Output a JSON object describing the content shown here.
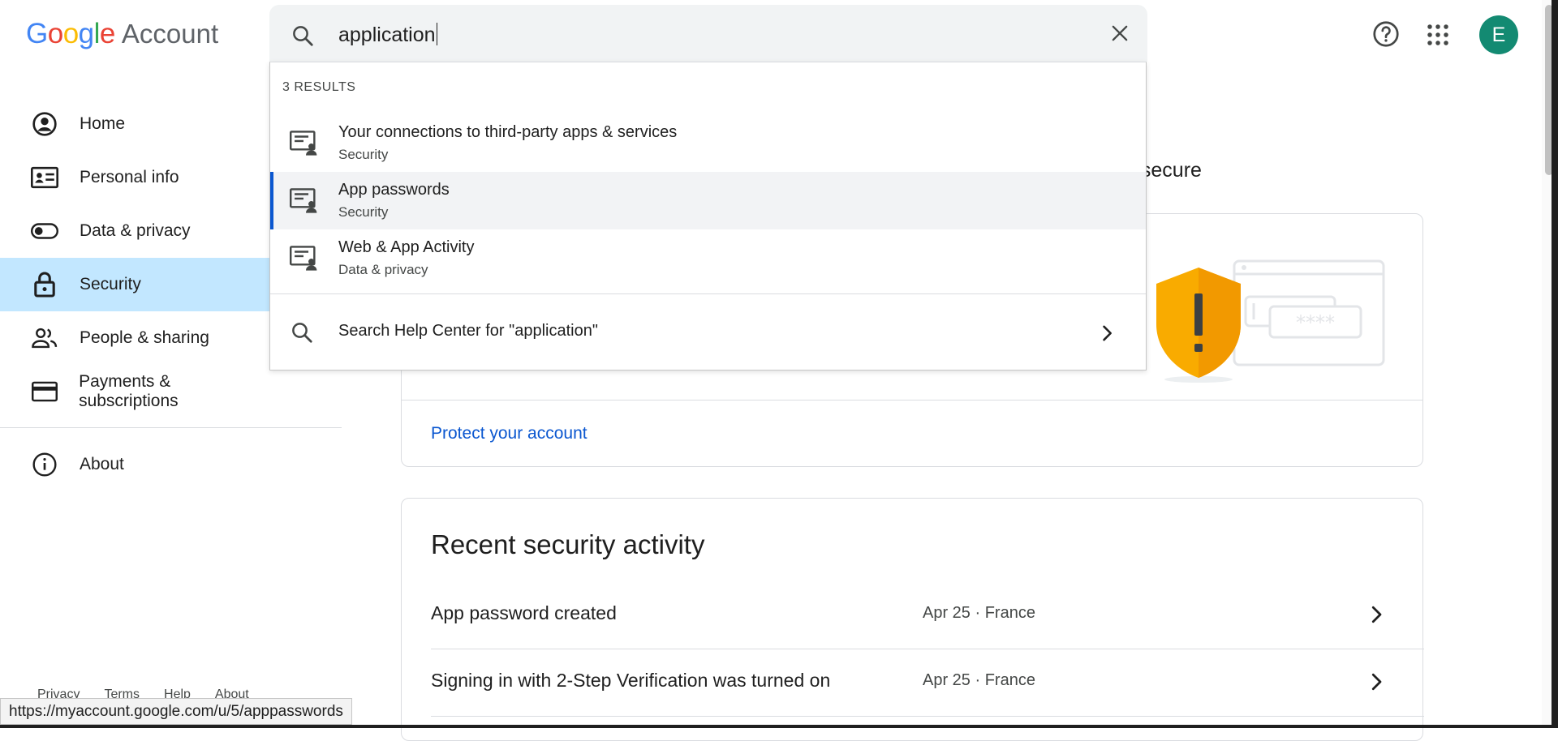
{
  "header": {
    "logo_text": "Google",
    "logo_suffix": "Account",
    "search_value": "application",
    "avatar_letter": "E"
  },
  "sidebar": {
    "items": [
      {
        "label": "Home",
        "icon": "account-circle-icon"
      },
      {
        "label": "Personal info",
        "icon": "id-card-icon"
      },
      {
        "label": "Data & privacy",
        "icon": "toggle-icon"
      },
      {
        "label": "Security",
        "icon": "lock-icon",
        "active": true
      },
      {
        "label": "People & sharing",
        "icon": "people-icon"
      },
      {
        "label": "Payments & subscriptions",
        "icon": "credit-card-icon"
      },
      {
        "label": "About",
        "icon": "info-icon"
      }
    ],
    "footer_links": [
      "Privacy",
      "Terms",
      "Help",
      "About"
    ]
  },
  "search_results": {
    "count_label": "3 RESULTS",
    "items": [
      {
        "title": "Your connections to third-party apps & services",
        "category": "Security"
      },
      {
        "title": "App passwords",
        "category": "Security",
        "highlighted": true
      },
      {
        "title": "Web & App Activity",
        "category": "Data & privacy"
      }
    ],
    "help_center_label": "Search Help Center for \"application\""
  },
  "main": {
    "partial_subtitle": "t secure",
    "protect_link": "Protect your account",
    "recent_activity": {
      "title": "Recent security activity",
      "rows": [
        {
          "event": "App password created",
          "meta": "Apr 25 · France"
        },
        {
          "event": "Signing in with 2-Step Verification was turned on",
          "meta": "Apr 25 · France"
        }
      ]
    }
  },
  "status_bar": {
    "url": "https://myaccount.google.com/u/5/apppasswords"
  },
  "colors": {
    "accent_blue": "#0b57d0",
    "active_nav_bg": "#c2e7ff",
    "avatar_bg": "#138a72",
    "shield_orange": "#f29900"
  }
}
